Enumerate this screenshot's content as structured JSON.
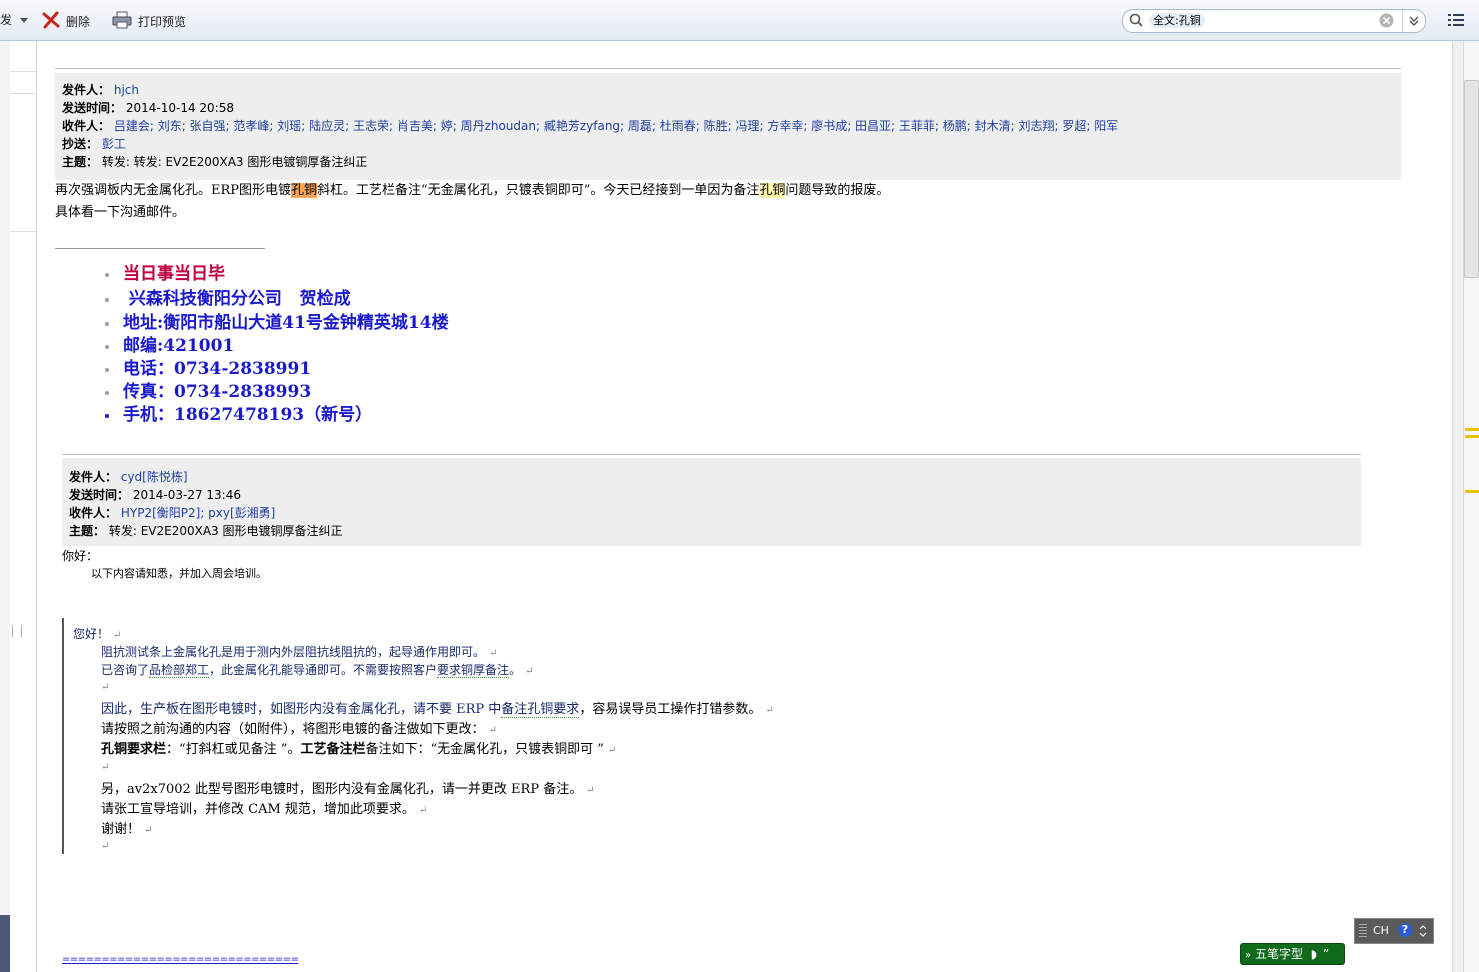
{
  "toolbar": {
    "forward_fragment": "发",
    "delete_label": "删除",
    "print_preview_label": "打印预览",
    "search_tag": "全文:孔铜"
  },
  "email1": {
    "from_label": "发件人：",
    "from_value": "hjch",
    "sent_label": "发送时间：",
    "sent_value": "2014-10-14 20:58",
    "to_label": "收件人：",
    "to_value": "吕建会; 刘东; 张自强; 范孝峰; 刘瑶; 陆应灵; 王志荣; 肖吉美; 婷; 周丹zhoudan; 臧艳芳zyfang; 周磊; 杜雨春; 陈胜; 冯理; 方幸幸; 廖书成; 田昌亚; 王菲菲; 杨鹏; 封木清; 刘志翔; 罗超; 阳军",
    "cc_label": "抄送：",
    "cc_value": "彭工",
    "subject_label": "主题：",
    "subject_value": "转发: 转发: EV2E200XA3 图形电镀铜厚备注纠正",
    "body_line1_a": "再次强调板内无金属化孔。ERP图形电镀",
    "body_line1_hl1": "孔铜",
    "body_line1_b": "斜杠。工艺栏备注“无金属化孔，只镀表铜即可”。今天已经接到一单因为备注",
    "body_line1_hl2": "孔铜",
    "body_line1_c": "问题导致的报废。",
    "body_line2": "具体看一下沟通邮件。"
  },
  "signature": [
    "当日事当日毕",
    " 兴森科技衡阳分公司   贺检成",
    "地址:衡阳市船山大道41号金钟精英城14楼",
    "邮编:421001",
    "电话：0734-2838991",
    "传真：0734-2838993",
    "手机：18627478193（新号）"
  ],
  "signature_colors": {
    "first": "#c0003c",
    "rest": "#1a1acc"
  },
  "email2": {
    "from_label": "发件人：",
    "from_value": "cyd[陈悦栋]",
    "sent_label": "发送时间：",
    "sent_value": "2014-03-27 13:46",
    "to_label": "收件人：",
    "to_value": "HYP2[衡阳P2]; pxy[彭湘勇]",
    "subject_label": "主题：",
    "subject_value": "转发: EV2E200XA3 图形电镀铜厚备注纠正",
    "greeting": "你好：",
    "intro": "以下内容请知悉，并加入周会培训。"
  },
  "quoted": {
    "l1": "您好！",
    "l2": "阻抗测试条上金属化孔是用于测内外层阻抗线阻抗的，起导通作用即可。",
    "l3a": "已咨询了",
    "l3b": "品检部郑工",
    "l3c": "，此金属化孔能导通即可。不需要按照客户",
    "l3d": "要求铜厚备注",
    "l3e": "。",
    "l5a": "因此，生产板在图形电镀时，如图形内没有金属化孔，请不要 ERP 中",
    "l5b": "备注孔铜要求",
    "l5c": "，容易误导员工操作打错参数。",
    "l6": "请按照之前沟通的内容（如附件），将图形电镀的备注做如下更改：",
    "l7a": "孔铜要求栏",
    "l7b": "：“打斜杠或见备注 ”。",
    "l7c": "工艺备注栏",
    "l7d": "备注如下：“无金属化孔，只镀表铜即可 ”",
    "l9": "另，av2x7002 此型号图形电镀时，图形内没有金属化孔，请一并更改 ERP 备注。",
    "l10": "请张工宣导培训，并修改 CAM 规范，增加此项要求。",
    "l11": "谢谢！",
    "return_mark": "↵"
  },
  "footer_rule": "==============================",
  "ime": {
    "lang": "CH",
    "help": "?",
    "wubi": "五笔字型"
  }
}
